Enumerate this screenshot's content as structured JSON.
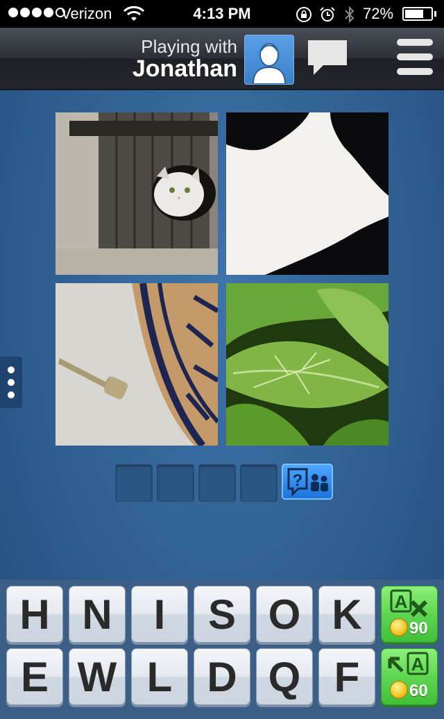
{
  "status_bar": {
    "carrier": "Verizon",
    "time": "4:13 PM",
    "battery": "72%",
    "battery_level": 0.72,
    "signal_bars": 4,
    "icons": [
      "wifi-icon",
      "rotation-lock-icon",
      "alarm-icon",
      "bluetooth-icon",
      "battery-icon"
    ]
  },
  "header": {
    "subtitle": "Playing with",
    "opponent": "Jonathan",
    "icons": [
      "avatar-icon",
      "chat-icon",
      "menu-icon"
    ]
  },
  "puzzle": {
    "images": [
      {
        "name": "cat-in-door-hole-photo"
      },
      {
        "name": "cow-hide-photo"
      },
      {
        "name": "key-on-doormat-photo"
      },
      {
        "name": "stick-insect-on-leaf-photo"
      }
    ],
    "answer_length": 4,
    "answer_letters": [
      "",
      "",
      "",
      ""
    ],
    "help_icon": "ask-friends-icon"
  },
  "keyboard": {
    "row1": [
      "H",
      "N",
      "I",
      "S",
      "O",
      "K"
    ],
    "row2": [
      "E",
      "W",
      "L",
      "D",
      "Q",
      "F"
    ],
    "powerups": [
      {
        "name": "remove-letters",
        "icon": "letter-remove-icon",
        "cost": "90"
      },
      {
        "name": "reveal-letter",
        "icon": "letter-reveal-icon",
        "cost": "60"
      }
    ]
  },
  "colors": {
    "background": "#2f5f93",
    "keyboard": "#3b5f86",
    "powerup_green": "#5fd651",
    "help_blue": "#1b73dc"
  }
}
